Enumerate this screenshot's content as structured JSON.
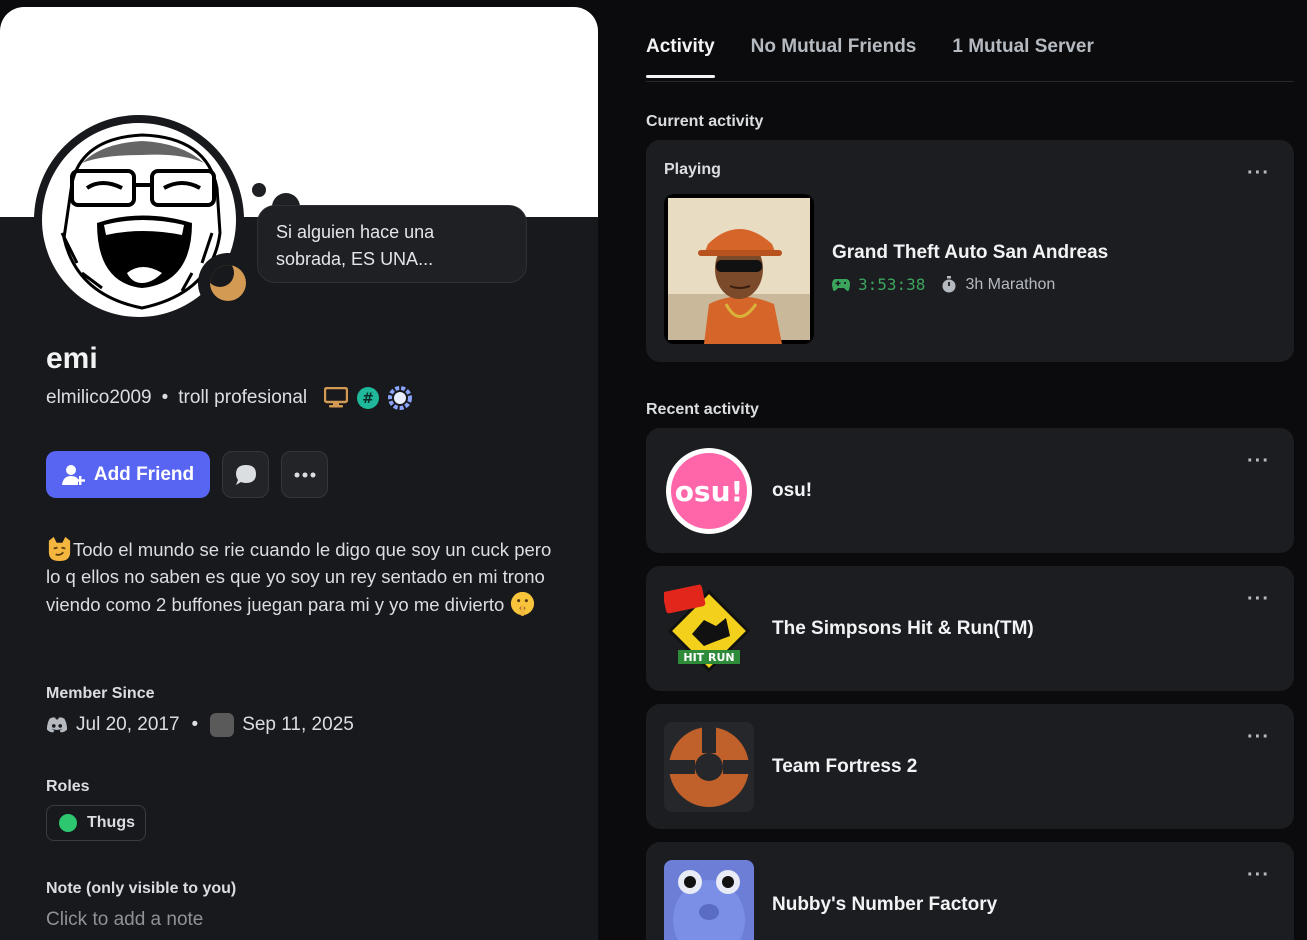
{
  "profile": {
    "bubble_text": "Si alguien hace una sobrada, ES UNA...",
    "display_name": "emi",
    "username": "elmilico2009",
    "separator": "•",
    "pronoun_tag": "troll profesional",
    "badges": [
      "monitor-badge",
      "hashtag-badge",
      "nitro-badge"
    ],
    "add_friend_label": "Add Friend",
    "bio_line1": "Todo el mundo se rie cuando le digo que soy un cuck pero lo q ellos no saben es que yo soy un rey sentado en mi trono viendo como 2 buffones juegan para mi y yo me divierto",
    "member_since_label": "Member Since",
    "discord_joined": "Jul 20, 2017",
    "dot": "•",
    "server_joined": "Sep 11, 2025",
    "roles_label": "Roles",
    "role_name": "Thugs",
    "note_label": "Note (only visible to you)",
    "note_placeholder": "Click to add a note"
  },
  "tabs": [
    {
      "label": "Activity",
      "active": true
    },
    {
      "label": "No Mutual Friends",
      "active": false
    },
    {
      "label": "1 Mutual Server",
      "active": false
    }
  ],
  "current": {
    "section_label": "Current activity",
    "playing_label": "Playing",
    "game_title": "Grand Theft Auto San Andreas",
    "elapsed": "3:53:38",
    "badge_text": "3h Marathon",
    "more": "···"
  },
  "recent": {
    "section_label": "Recent activity",
    "items": [
      {
        "name": "osu!",
        "more": "···"
      },
      {
        "name": "The Simpsons Hit & Run(TM)",
        "more": "···"
      },
      {
        "name": "Team Fortress 2",
        "more": "···"
      },
      {
        "name": "Nubby's Number Factory",
        "more": "···"
      }
    ]
  },
  "colors": {
    "accent": "#5865f2",
    "role_color": "#2dc770",
    "timer_green": "#3ba55c",
    "status_idle": "#d39a54"
  }
}
